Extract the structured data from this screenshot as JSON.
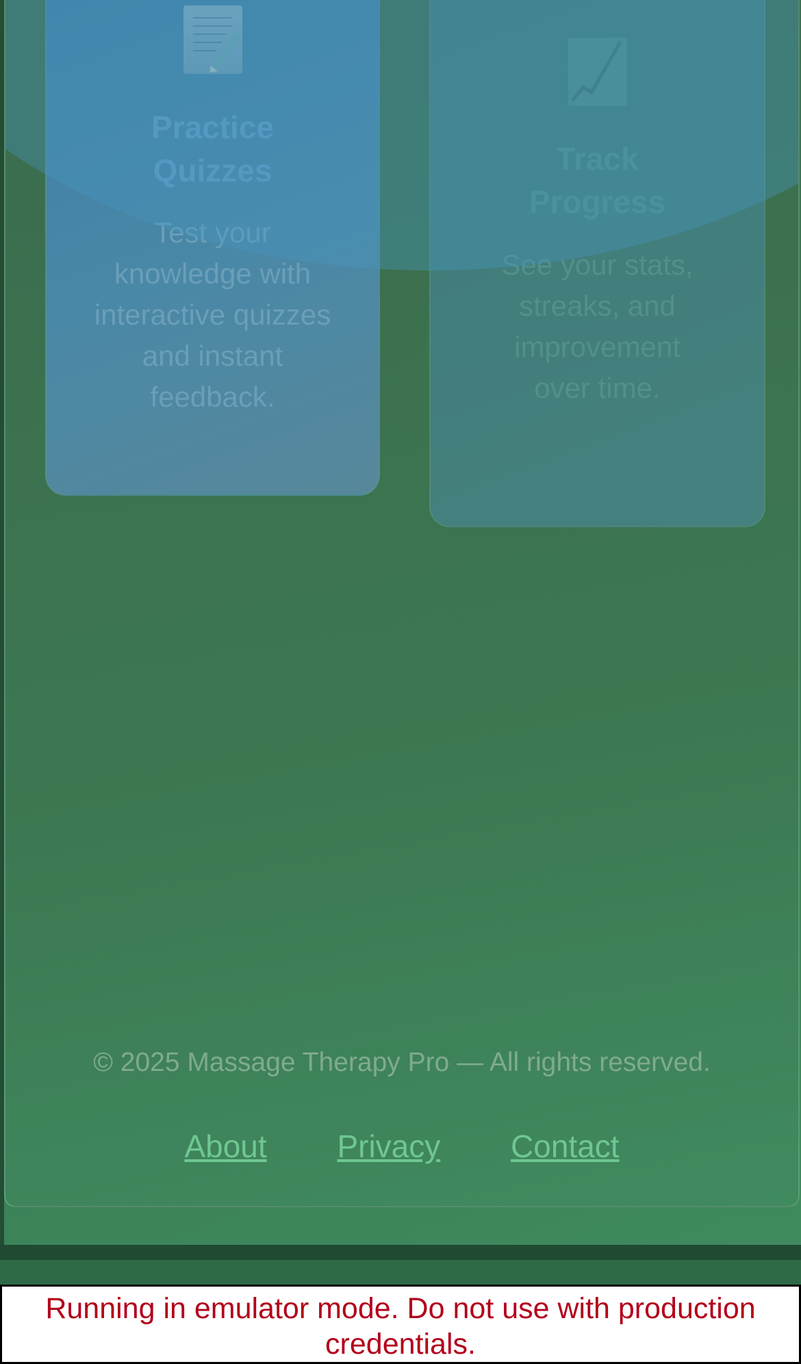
{
  "features": [
    {
      "icon": "memo-pencil-icon",
      "title": "Practice Quizzes",
      "description": "Test your knowledge with interactive quizzes and instant feedback."
    },
    {
      "icon": "chart-increasing-icon",
      "title": "Track Progress",
      "description": "See your stats, streaks, and improvement over time."
    }
  ],
  "footer": {
    "copyright": "© 2025 Massage Therapy Pro — All rights reserved.",
    "links": [
      "About",
      "Privacy",
      "Contact"
    ]
  },
  "emulator_banner": "Running in emulator mode. Do not use with production credentials."
}
